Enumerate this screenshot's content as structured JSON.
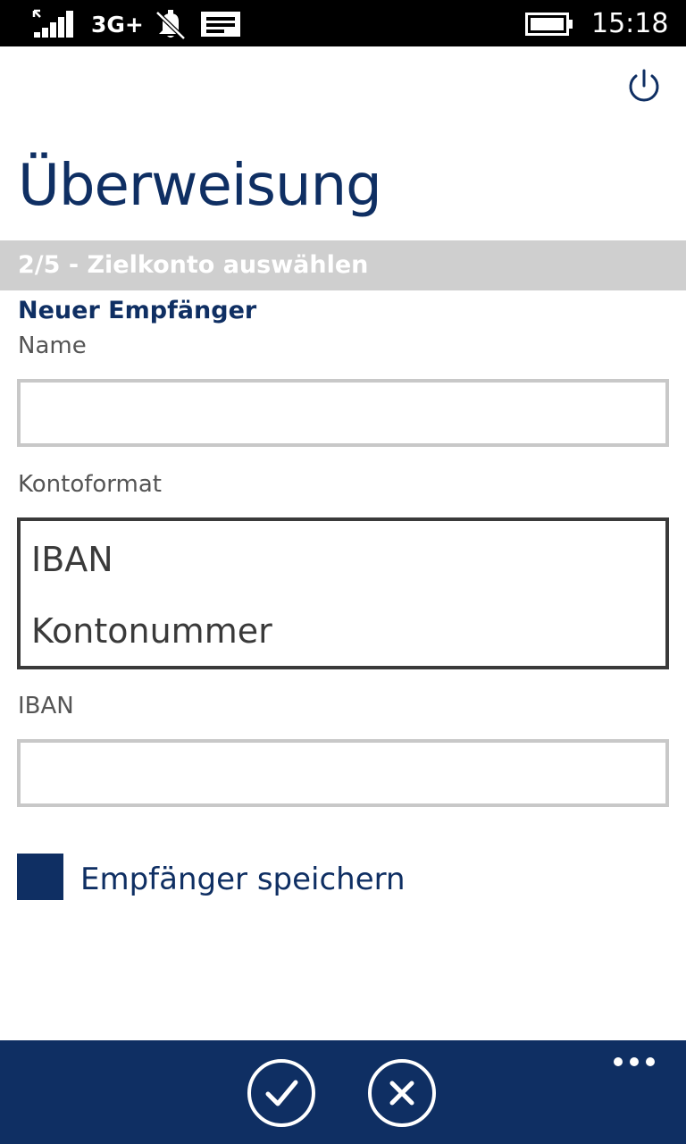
{
  "status_bar": {
    "network": "3G+",
    "time": "15:18",
    "icons": [
      "signal-icon",
      "silent-bell-icon",
      "message-icon",
      "battery-icon"
    ]
  },
  "header": {
    "title": "Überweisung",
    "power_icon": "power-icon"
  },
  "step": {
    "text": "2/5 - Zielkonto auswählen"
  },
  "form": {
    "section_heading": "Neuer Empfänger",
    "name_label": "Name",
    "name_value": "",
    "format_label": "Kontoformat",
    "format_options": [
      "IBAN",
      "Kontonummer"
    ],
    "iban_label": "IBAN",
    "iban_value": "",
    "save_recipient_label": "Empfänger speichern"
  },
  "app_bar": {
    "buttons": [
      "confirm-icon",
      "cancel-icon"
    ],
    "more_icon": "more-icon"
  },
  "colors": {
    "accent": "#0f2f63",
    "step_bar": "#cfcfcf",
    "input_border": "#c8c8c8",
    "listbox_border": "#3a3a3a"
  }
}
